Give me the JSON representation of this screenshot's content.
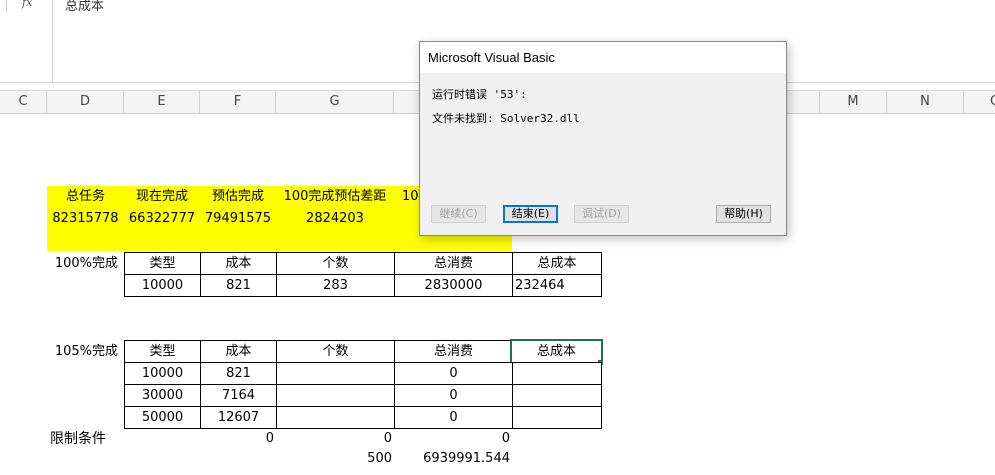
{
  "formula_bar": {
    "fx_label": "fx",
    "content": "总成本"
  },
  "columns": [
    "C",
    "D",
    "E",
    "F",
    "G",
    "M",
    "N",
    "O"
  ],
  "header_row": {
    "labels": [
      "总任务",
      "现在完成",
      "预估完成",
      "100完成预估差距",
      "10"
    ],
    "values": [
      "82315778",
      "66322777",
      "79491575",
      "2824203"
    ]
  },
  "table100": {
    "row_label": "100%完成",
    "headers": [
      "类型",
      "成本",
      "个数",
      "总消费",
      "总成本"
    ],
    "row": [
      "10000",
      "821",
      "283",
      "2830000",
      "232464"
    ]
  },
  "table105": {
    "row_label": "105%完成",
    "headers": [
      "类型",
      "成本",
      "个数",
      "总消费",
      "总成本"
    ],
    "rows": [
      [
        "10000",
        "821",
        "",
        "0",
        ""
      ],
      [
        "30000",
        "7164",
        "",
        "0",
        ""
      ],
      [
        "50000",
        "12607",
        "",
        "0",
        ""
      ]
    ]
  },
  "constraints": {
    "label": "限制条件",
    "values": [
      "0",
      "0",
      "0"
    ],
    "row2": [
      "500",
      "6939991.544"
    ]
  },
  "dialog": {
    "title": "Microsoft Visual Basic",
    "line1": "运行时错误 '53':",
    "line2": "文件未找到: Solver32.dll",
    "buttons": {
      "continue": "继续(C)",
      "end": "结束(E)",
      "debug": "调试(D)",
      "help": "帮助(H)"
    }
  }
}
